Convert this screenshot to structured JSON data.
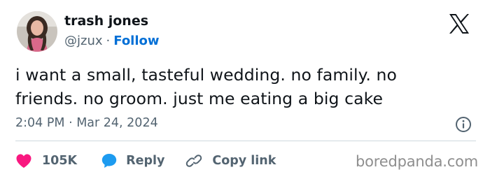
{
  "author": {
    "name": "trash jones",
    "handle": "@jzux",
    "separator": "·",
    "follow_label": "Follow"
  },
  "tweet": {
    "text_line1": "i want a small, tasteful wedding. no family. no",
    "text_line2": "friends. no groom. just me eating a big cake",
    "timestamp": "2:04 PM · Mar 24, 2024"
  },
  "actions": {
    "like_count": "105K",
    "reply_label": "Reply",
    "copy_link_label": "Copy link"
  },
  "icons": {
    "x_logo": "x-logo-icon",
    "info": "info-icon",
    "heart": "heart-icon",
    "reply": "reply-bubble-icon",
    "link": "link-icon"
  },
  "colors": {
    "like": "#f91880",
    "reply": "#1d9bf0",
    "follow": "#006fd6",
    "secondary_text": "#536471"
  },
  "watermark": "boredpanda.com"
}
